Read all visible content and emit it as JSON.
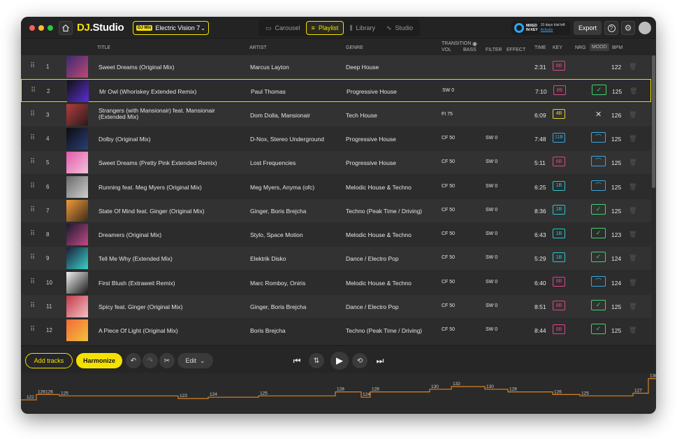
{
  "app": {
    "logo_dj": "DJ",
    "logo_rest": ".Studio",
    "mix_tag": "DJ Mix",
    "mix_name": "Electric Vision 7",
    "tabs": [
      {
        "label": "Carousel",
        "icon": "carousel-icon",
        "active": false
      },
      {
        "label": "Playlist",
        "icon": "playlist-icon",
        "active": true
      },
      {
        "label": "Library",
        "icon": "library-icon",
        "active": false
      },
      {
        "label": "Studio",
        "icon": "studio-icon",
        "active": false
      }
    ],
    "mik_brand_1": "MIXED",
    "mik_brand_2": "IN KEY",
    "trial_text": "10 days trial left",
    "trial_action": "Activate",
    "export_label": "Export"
  },
  "columns": {
    "title": "TITLE",
    "artist": "ARTIST",
    "genre": "GENRE",
    "transition": "TRANSITION",
    "vol": "VOL",
    "bass": "BASS",
    "filter": "FILTER",
    "effect": "EFFECT",
    "time": "TIME",
    "key": "KEY",
    "nrg": "NRG",
    "mood": "MOOD",
    "bpm": "BPM"
  },
  "tracks": [
    {
      "n": "1",
      "title": "Sweet Dreams (Original Mix)",
      "artist": "Marcus Layton",
      "genre": "Deep House",
      "tr1": "",
      "tr2": "",
      "time": "2:31",
      "key": "8B",
      "mood": "",
      "bpm": "122"
    },
    {
      "n": "2",
      "title": "Mr Owl (Whoriskey Extended Remix)",
      "artist": "Paul Thomas",
      "genre": "Progressive House",
      "tr1": "SW 0",
      "tr2": "",
      "time": "7:10",
      "key": "8B",
      "mood": "check",
      "bpm": "125"
    },
    {
      "n": "3",
      "title": "Strangers (with Mansionair) feat. Mansionair (Extended Mix)",
      "artist": "Dom Dolla, Mansionair",
      "genre": "Tech House",
      "tr1": "FI 75",
      "tr2": "",
      "time": "6:09",
      "key": "4B",
      "mood": "x",
      "bpm": "126"
    },
    {
      "n": "4",
      "title": "Dolby (Original Mix)",
      "artist": "D-Nox, Stereo Underground",
      "genre": "Progressive House",
      "tr1": "CF 50",
      "tr2": "SW 0",
      "time": "7:48",
      "key": "11B",
      "mood": "wave",
      "bpm": "125"
    },
    {
      "n": "5",
      "title": "Sweet Dreams (Pretty Pink Extended Remix)",
      "artist": "Lost Frequencies",
      "genre": "Progressive House",
      "tr1": "CF 50",
      "tr2": "SW 0",
      "time": "5:11",
      "key": "6B",
      "mood": "wave",
      "bpm": "125"
    },
    {
      "n": "6",
      "title": "Running feat. Meg Myers (Original Mix)",
      "artist": "Meg Myers, Anyma (ofc)",
      "genre": "Melodic House & Techno",
      "tr1": "CF 50",
      "tr2": "SW 0",
      "time": "6:25",
      "key": "1B",
      "mood": "wave",
      "bpm": "125"
    },
    {
      "n": "7",
      "title": "State Of Mind feat. Ginger (Original Mix)",
      "artist": "Ginger, Boris Brejcha",
      "genre": "Techno (Peak Time / Driving)",
      "tr1": "CF 50",
      "tr2": "SW 0",
      "time": "8:36",
      "key": "1B",
      "mood": "check",
      "bpm": "125"
    },
    {
      "n": "8",
      "title": "Dreamers (Original Mix)",
      "artist": "Stylo, Space Motion",
      "genre": "Melodic House & Techno",
      "tr1": "CF 50",
      "tr2": "SW 0",
      "time": "6:43",
      "key": "1B",
      "mood": "check",
      "bpm": "123"
    },
    {
      "n": "9",
      "title": "Tell Me Why (Extended Mix)",
      "artist": "Elektrik Disko",
      "genre": "Dance / Electro Pop",
      "tr1": "CF 50",
      "tr2": "SW 0",
      "time": "5:29",
      "key": "1B",
      "mood": "check",
      "bpm": "124"
    },
    {
      "n": "10",
      "title": "First Blush (Extraweit Remix)",
      "artist": "Marc Romboy, Oniris",
      "genre": "Melodic House & Techno",
      "tr1": "CF 50",
      "tr2": "SW 0",
      "time": "6:40",
      "key": "8B",
      "mood": "wave",
      "bpm": "124"
    },
    {
      "n": "11",
      "title": "Spicy feat. Ginger (Original Mix)",
      "artist": "Ginger, Boris Brejcha",
      "genre": "Dance / Electro Pop",
      "tr1": "CF 50",
      "tr2": "SW 0",
      "time": "8:51",
      "key": "8B",
      "mood": "check",
      "bpm": "125"
    },
    {
      "n": "12",
      "title": "A Piece Of Light (Original Mix)",
      "artist": "Boris Brejcha",
      "genre": "Techno (Peak Time / Driving)",
      "tr1": "CF 50",
      "tr2": "SW 0",
      "time": "8:44",
      "key": "8B",
      "mood": "check",
      "bpm": "125"
    }
  ],
  "colors": {
    "accent": "#f5e100",
    "key_8B": "#e0458a",
    "key_4B": "#e6d13a",
    "key_11B": "#3aa6e0",
    "key_6B": "#e0458a",
    "key_1B": "#27c7d1",
    "mood_check": "#3fd46a",
    "mood_wave": "#3aa6e0",
    "bpm_line": "#d98324"
  },
  "art_colors": [
    [
      "#3b2a6d",
      "#c0487a"
    ],
    [
      "#111",
      "#5b2fd6"
    ],
    [
      "#b33d3d",
      "#2a1a1a"
    ],
    [
      "#0c0c0c",
      "#2a3e7a"
    ],
    [
      "#e25aa9",
      "#f3c2df"
    ],
    [
      "#6a6a6a",
      "#cfcfcf"
    ],
    [
      "#f29a3a",
      "#3a2a1a"
    ],
    [
      "#1a1a2a",
      "#c24a8a"
    ],
    [
      "#1b1e3a",
      "#3ad1c7"
    ],
    [
      "#f2f2f2",
      "#1a1a1a"
    ],
    [
      "#c23a4a",
      "#f2c2c2"
    ],
    [
      "#f26a3a",
      "#f2c23a"
    ]
  ],
  "bottom": {
    "add_tracks": "Add tracks",
    "harmonize": "Harmonize",
    "edit": "Edit"
  },
  "bpm_labels": [
    "122",
    "126",
    "126",
    "125",
    "123",
    "124",
    "125",
    "128",
    "124",
    "128",
    "130",
    "132",
    "130",
    "128",
    "126",
    "125",
    "127",
    "138"
  ]
}
